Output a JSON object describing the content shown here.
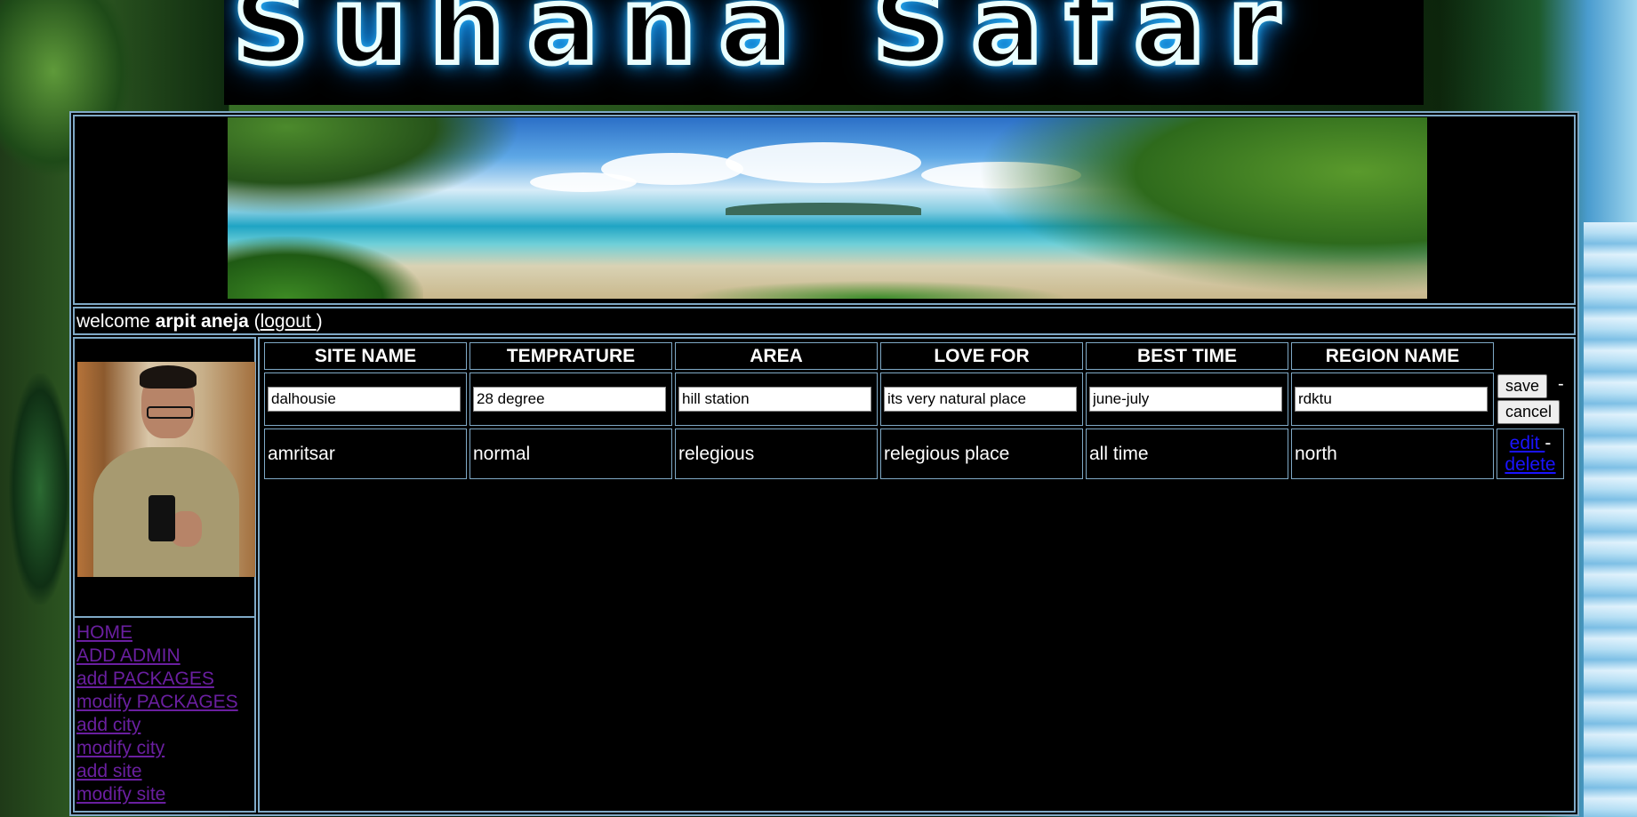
{
  "logo": {
    "text": "Suhana Safar"
  },
  "welcome": {
    "prefix": "welcome ",
    "username": "arpit aneja",
    "open_paren": " (",
    "logout_label": "logout ",
    "close_paren": ")"
  },
  "nav": {
    "items": [
      {
        "label": "HOME"
      },
      {
        "label": "ADD ADMIN"
      },
      {
        "label": "add PACKAGES"
      },
      {
        "label": "modify PACKAGES"
      },
      {
        "label": "add city"
      },
      {
        "label": "modify city"
      },
      {
        "label": "add site"
      },
      {
        "label": "modify site"
      }
    ]
  },
  "table": {
    "headers": [
      "SITE NAME",
      "TEMPRATURE",
      "AREA",
      "LOVE FOR",
      "BEST TIME",
      "REGION NAME"
    ],
    "edit_row": [
      "dalhousie",
      "28 degree",
      "hill station",
      "its very natural place",
      "june-july",
      "rdktu"
    ],
    "save_label": "save",
    "separator": "-",
    "cancel_label": "cancel",
    "rows": [
      {
        "cells": [
          "amritsar",
          "normal",
          "relegious",
          "relegious place",
          "all time",
          "north"
        ]
      }
    ],
    "edit_label": "edit ",
    "dash": "-",
    "delete_label": "delete"
  },
  "colors": {
    "frame_border": "#7fa9c6",
    "visited_link": "#6a1fa0",
    "link": "#1a14ff",
    "background": "#000000"
  }
}
